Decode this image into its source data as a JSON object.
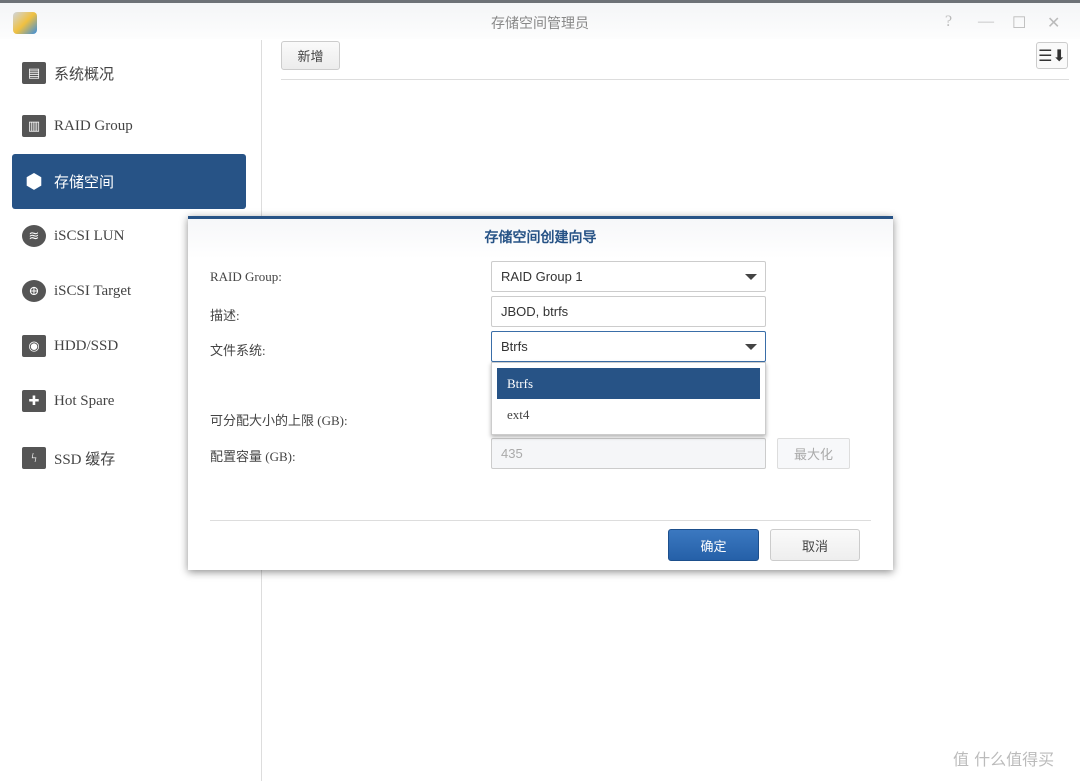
{
  "window": {
    "title": "存储空间管理员",
    "controls": [
      "?",
      "—",
      "☐",
      "✕"
    ]
  },
  "toolbar": {
    "add_label": "新增",
    "sort_icon": "☰⬇"
  },
  "sidebar": {
    "items": [
      {
        "label": "系统概况",
        "icon": "overview-icon",
        "glyph": "▤"
      },
      {
        "label": "RAID Group",
        "icon": "raid-icon",
        "glyph": "▥"
      },
      {
        "label": "存储空间",
        "icon": "cubes-icon",
        "glyph": "⬢",
        "active": true
      },
      {
        "label": "iSCSI LUN",
        "icon": "database-icon",
        "glyph": "≋"
      },
      {
        "label": "iSCSI Target",
        "icon": "globe-icon",
        "glyph": "⊕"
      },
      {
        "label": "HDD/SSD",
        "icon": "disk-icon",
        "glyph": "◉"
      },
      {
        "label": "Hot Spare",
        "icon": "hot-spare-icon",
        "glyph": "✚"
      },
      {
        "label": "SSD 缓存",
        "icon": "ssd-cache-icon",
        "glyph": "ϟ"
      }
    ]
  },
  "dialog": {
    "title": "存储空间创建向导",
    "raid_label": "RAID Group:",
    "raid_value": "RAID Group 1",
    "desc_label": "描述:",
    "desc_value": "JBOD, btrfs",
    "fs_label": "文件系统:",
    "fs_value": "Btrfs",
    "fs_options": [
      "Btrfs",
      "ext4"
    ],
    "max_label": "可分配大小的上限 (GB):",
    "cap_label": "配置容量 (GB):",
    "cap_value": "435",
    "max_button": "最大化",
    "ok": "确定",
    "cancel": "取消"
  },
  "accent_color": "#275386",
  "watermark": "值 什么值得买"
}
